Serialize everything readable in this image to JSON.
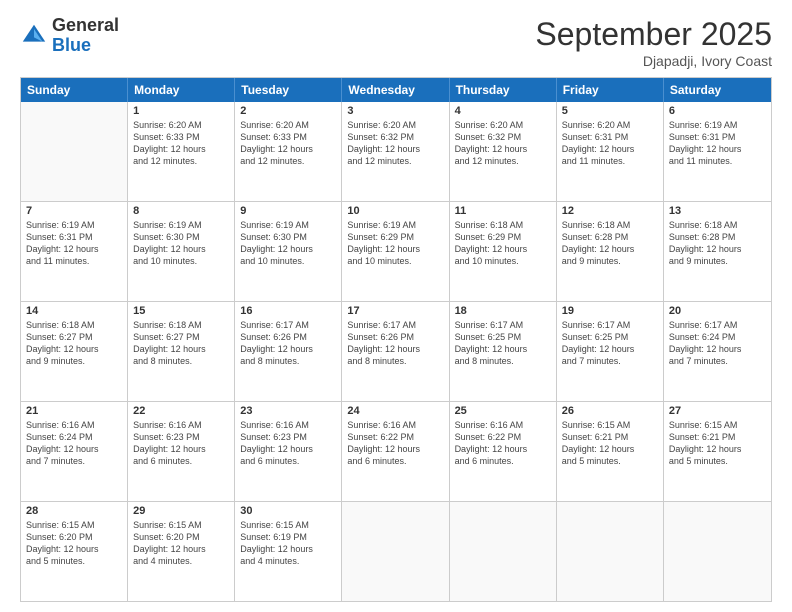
{
  "logo": {
    "general": "General",
    "blue": "Blue"
  },
  "title": "September 2025",
  "location": "Djapadji, Ivory Coast",
  "days": [
    "Sunday",
    "Monday",
    "Tuesday",
    "Wednesday",
    "Thursday",
    "Friday",
    "Saturday"
  ],
  "weeks": [
    [
      {
        "day": "",
        "info": ""
      },
      {
        "day": "1",
        "info": "Sunrise: 6:20 AM\nSunset: 6:33 PM\nDaylight: 12 hours\nand 12 minutes."
      },
      {
        "day": "2",
        "info": "Sunrise: 6:20 AM\nSunset: 6:33 PM\nDaylight: 12 hours\nand 12 minutes."
      },
      {
        "day": "3",
        "info": "Sunrise: 6:20 AM\nSunset: 6:32 PM\nDaylight: 12 hours\nand 12 minutes."
      },
      {
        "day": "4",
        "info": "Sunrise: 6:20 AM\nSunset: 6:32 PM\nDaylight: 12 hours\nand 12 minutes."
      },
      {
        "day": "5",
        "info": "Sunrise: 6:20 AM\nSunset: 6:31 PM\nDaylight: 12 hours\nand 11 minutes."
      },
      {
        "day": "6",
        "info": "Sunrise: 6:19 AM\nSunset: 6:31 PM\nDaylight: 12 hours\nand 11 minutes."
      }
    ],
    [
      {
        "day": "7",
        "info": "Sunrise: 6:19 AM\nSunset: 6:31 PM\nDaylight: 12 hours\nand 11 minutes."
      },
      {
        "day": "8",
        "info": "Sunrise: 6:19 AM\nSunset: 6:30 PM\nDaylight: 12 hours\nand 10 minutes."
      },
      {
        "day": "9",
        "info": "Sunrise: 6:19 AM\nSunset: 6:30 PM\nDaylight: 12 hours\nand 10 minutes."
      },
      {
        "day": "10",
        "info": "Sunrise: 6:19 AM\nSunset: 6:29 PM\nDaylight: 12 hours\nand 10 minutes."
      },
      {
        "day": "11",
        "info": "Sunrise: 6:18 AM\nSunset: 6:29 PM\nDaylight: 12 hours\nand 10 minutes."
      },
      {
        "day": "12",
        "info": "Sunrise: 6:18 AM\nSunset: 6:28 PM\nDaylight: 12 hours\nand 9 minutes."
      },
      {
        "day": "13",
        "info": "Sunrise: 6:18 AM\nSunset: 6:28 PM\nDaylight: 12 hours\nand 9 minutes."
      }
    ],
    [
      {
        "day": "14",
        "info": "Sunrise: 6:18 AM\nSunset: 6:27 PM\nDaylight: 12 hours\nand 9 minutes."
      },
      {
        "day": "15",
        "info": "Sunrise: 6:18 AM\nSunset: 6:27 PM\nDaylight: 12 hours\nand 8 minutes."
      },
      {
        "day": "16",
        "info": "Sunrise: 6:17 AM\nSunset: 6:26 PM\nDaylight: 12 hours\nand 8 minutes."
      },
      {
        "day": "17",
        "info": "Sunrise: 6:17 AM\nSunset: 6:26 PM\nDaylight: 12 hours\nand 8 minutes."
      },
      {
        "day": "18",
        "info": "Sunrise: 6:17 AM\nSunset: 6:25 PM\nDaylight: 12 hours\nand 8 minutes."
      },
      {
        "day": "19",
        "info": "Sunrise: 6:17 AM\nSunset: 6:25 PM\nDaylight: 12 hours\nand 7 minutes."
      },
      {
        "day": "20",
        "info": "Sunrise: 6:17 AM\nSunset: 6:24 PM\nDaylight: 12 hours\nand 7 minutes."
      }
    ],
    [
      {
        "day": "21",
        "info": "Sunrise: 6:16 AM\nSunset: 6:24 PM\nDaylight: 12 hours\nand 7 minutes."
      },
      {
        "day": "22",
        "info": "Sunrise: 6:16 AM\nSunset: 6:23 PM\nDaylight: 12 hours\nand 6 minutes."
      },
      {
        "day": "23",
        "info": "Sunrise: 6:16 AM\nSunset: 6:23 PM\nDaylight: 12 hours\nand 6 minutes."
      },
      {
        "day": "24",
        "info": "Sunrise: 6:16 AM\nSunset: 6:22 PM\nDaylight: 12 hours\nand 6 minutes."
      },
      {
        "day": "25",
        "info": "Sunrise: 6:16 AM\nSunset: 6:22 PM\nDaylight: 12 hours\nand 6 minutes."
      },
      {
        "day": "26",
        "info": "Sunrise: 6:15 AM\nSunset: 6:21 PM\nDaylight: 12 hours\nand 5 minutes."
      },
      {
        "day": "27",
        "info": "Sunrise: 6:15 AM\nSunset: 6:21 PM\nDaylight: 12 hours\nand 5 minutes."
      }
    ],
    [
      {
        "day": "28",
        "info": "Sunrise: 6:15 AM\nSunset: 6:20 PM\nDaylight: 12 hours\nand 5 minutes."
      },
      {
        "day": "29",
        "info": "Sunrise: 6:15 AM\nSunset: 6:20 PM\nDaylight: 12 hours\nand 4 minutes."
      },
      {
        "day": "30",
        "info": "Sunrise: 6:15 AM\nSunset: 6:19 PM\nDaylight: 12 hours\nand 4 minutes."
      },
      {
        "day": "",
        "info": ""
      },
      {
        "day": "",
        "info": ""
      },
      {
        "day": "",
        "info": ""
      },
      {
        "day": "",
        "info": ""
      }
    ]
  ]
}
